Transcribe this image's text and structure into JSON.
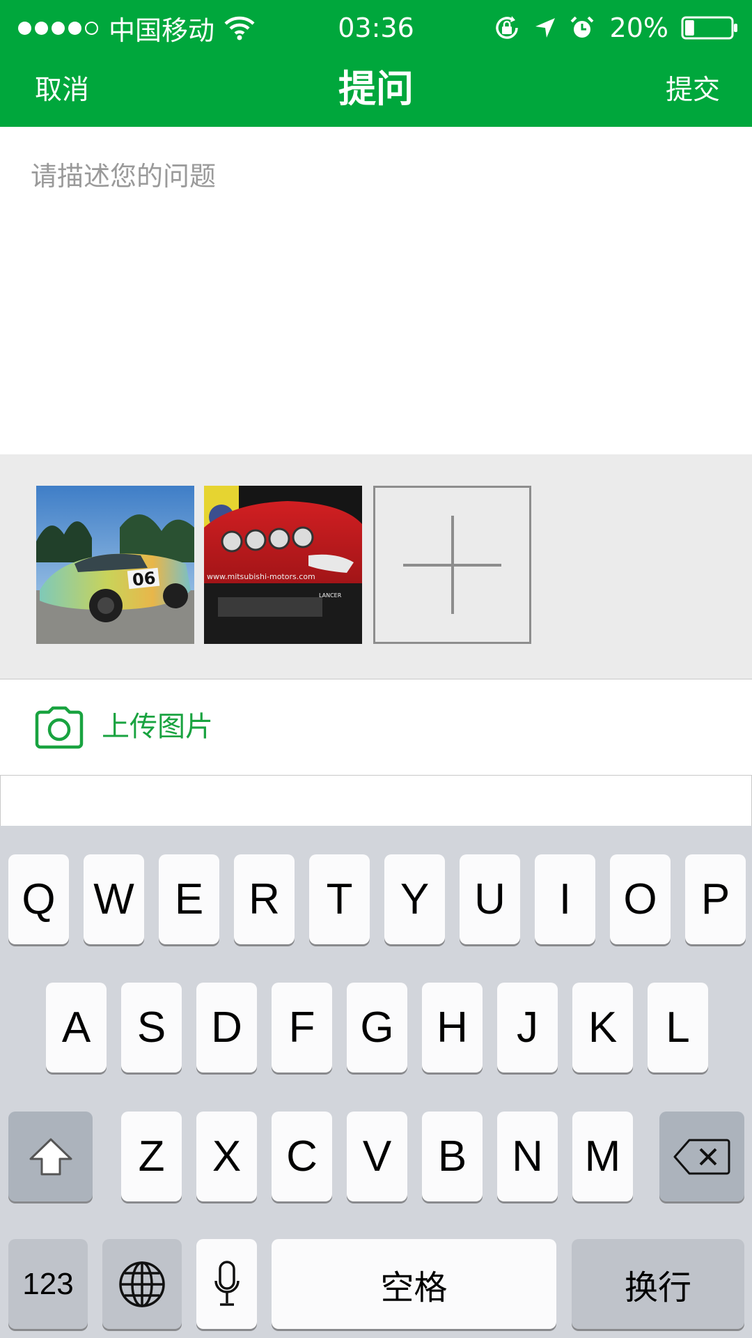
{
  "status_bar": {
    "carrier": "中国移动",
    "time": "03:36",
    "battery_percent": "20%",
    "battery_level": 0.2,
    "signal_bars_filled": 4,
    "signal_bars_total": 5
  },
  "nav": {
    "cancel_label": "取消",
    "title": "提问",
    "submit_label": "提交"
  },
  "question": {
    "placeholder": "请描述您的问题",
    "value": ""
  },
  "attachments": {
    "images": [
      {
        "description": "car-photo-green"
      },
      {
        "description": "car-photo-red"
      }
    ],
    "add_icon": "plus-icon"
  },
  "upload": {
    "icon": "camera-icon",
    "label": "上传图片"
  },
  "keyboard": {
    "row1": [
      "Q",
      "W",
      "E",
      "R",
      "T",
      "Y",
      "U",
      "I",
      "O",
      "P"
    ],
    "row2": [
      "A",
      "S",
      "D",
      "F",
      "G",
      "H",
      "J",
      "K",
      "L"
    ],
    "row3": [
      "Z",
      "X",
      "C",
      "V",
      "B",
      "N",
      "M"
    ],
    "numbers_label": "123",
    "space_label": "空格",
    "return_label": "换行",
    "shift_icon": "shift-icon",
    "delete_icon": "delete-icon",
    "globe_icon": "globe-icon",
    "mic_icon": "microphone-icon"
  },
  "colors": {
    "brand_green": "#00a73c",
    "upload_green": "#19a340",
    "strip_bg": "#ebebeb",
    "keyboard_bg": "#d2d5db"
  }
}
